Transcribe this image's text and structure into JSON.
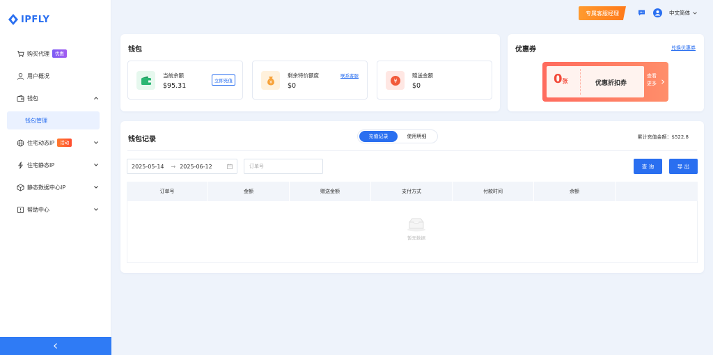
{
  "brand": {
    "name": "IPFLY"
  },
  "sidebar": {
    "items": [
      {
        "label": "购买代理",
        "badge": "优惠"
      },
      {
        "label": "用户概况"
      },
      {
        "label": "钱包"
      },
      {
        "label": "钱包管理"
      },
      {
        "label": "住宅动态IP",
        "badge": "活动"
      },
      {
        "label": "住宅静态IP"
      },
      {
        "label": "静态数据中心IP"
      },
      {
        "label": "帮助中心"
      }
    ]
  },
  "topbar": {
    "customer_service": "专属客服经理",
    "language": "中文简体"
  },
  "wallet": {
    "title": "钱包",
    "balance": {
      "label": "当前余额",
      "value": "$95.31",
      "action": "立即充值"
    },
    "special": {
      "label": "剩余特价额度",
      "value": "$0",
      "action": "联系客服"
    },
    "gift": {
      "label": "赠送金额",
      "value": "$0"
    }
  },
  "coupon": {
    "title": "优惠券",
    "redeem_link": "兑换优惠券",
    "count": "0",
    "count_unit": "张",
    "name": "优惠折扣券",
    "more_line1": "查看",
    "more_line2": "更多"
  },
  "records": {
    "title": "钱包记录",
    "tabs": [
      "充值记录",
      "使用明细"
    ],
    "total": "累计充值金额：$522.8",
    "date_start": "2025-05-14",
    "date_end": "2025-06-12",
    "order_placeholder": "订单号",
    "query_button": "查 询",
    "export_button": "导 出",
    "columns": [
      "订单号",
      "金额",
      "赠送金额",
      "支付方式",
      "付款时间",
      "余额"
    ],
    "empty_text": "暂无数据"
  },
  "colors": {
    "primary": "#2a6ff0",
    "orange": "#ff8a24",
    "coupon_red": "#f24a3a"
  }
}
